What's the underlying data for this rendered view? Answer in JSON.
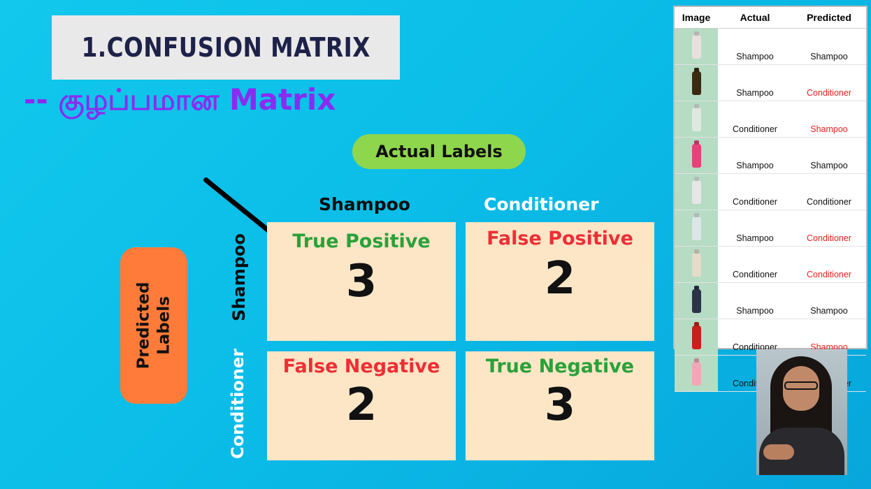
{
  "title": "1.CONFUSION MATRIX",
  "subtitle": "-- குழப்பமான Matrix",
  "actual_labels": "Actual Labels",
  "predicted_labels_line1": "Predicted",
  "predicted_labels_line2": "Labels",
  "columns": [
    "Shampoo",
    "Conditioner"
  ],
  "rows": [
    "Shampoo",
    "Conditioner"
  ],
  "cells": [
    {
      "label": "True Positive",
      "value": "3",
      "color": "#2aa13a"
    },
    {
      "label": "False Positive",
      "value": "2",
      "color": "#ee2e36"
    },
    {
      "label": "False Negative",
      "value": "2",
      "color": "#ee2e36"
    },
    {
      "label": "True Negative",
      "value": "3",
      "color": "#2aa13a"
    }
  ],
  "table": {
    "headers": [
      "Image",
      "Actual",
      "Predicted"
    ],
    "rows": [
      {
        "actual": "Shampoo",
        "predicted": "Shampoo",
        "mismatch": false,
        "bottle_color": "#e8e0dc"
      },
      {
        "actual": "Shampoo",
        "predicted": "Conditioner",
        "mismatch": true,
        "bottle_color": "#3b2a12"
      },
      {
        "actual": "Conditioner",
        "predicted": "Shampoo",
        "mismatch": true,
        "bottle_color": "#dfe8df"
      },
      {
        "actual": "Shampoo",
        "predicted": "Shampoo",
        "mismatch": false,
        "bottle_color": "#e8407a"
      },
      {
        "actual": "Conditioner",
        "predicted": "Conditioner",
        "mismatch": false,
        "bottle_color": "#e6e6e6"
      },
      {
        "actual": "Shampoo",
        "predicted": "Conditioner",
        "mismatch": true,
        "bottle_color": "#dce6e6"
      },
      {
        "actual": "Conditioner",
        "predicted": "Conditioner",
        "mismatch": true,
        "bottle_color": "#e4dcc8"
      },
      {
        "actual": "Shampoo",
        "predicted": "Shampoo",
        "mismatch": false,
        "bottle_color": "#2b3348"
      },
      {
        "actual": "Conditioner",
        "predicted": "Shampoo",
        "mismatch": true,
        "bottle_color": "#c8201c"
      },
      {
        "actual": "Conditioner",
        "predicted": "Conditioner",
        "mismatch": false,
        "bottle_color": "#f0a8b8"
      }
    ]
  }
}
